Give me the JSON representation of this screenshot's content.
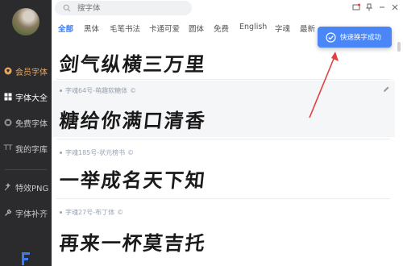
{
  "search": {
    "placeholder": "搜字体"
  },
  "sidebar": {
    "items": [
      {
        "label": "会员字体",
        "icon": "diamond-icon"
      },
      {
        "label": "字体大全",
        "icon": "grid-icon"
      },
      {
        "label": "免费字体",
        "icon": "free-icon"
      },
      {
        "label": "我的字库",
        "icon": "font-icon"
      },
      {
        "label": "特效PNG",
        "icon": "effect-icon"
      },
      {
        "label": "字体补齐",
        "icon": "wrench-icon"
      }
    ]
  },
  "tabs": [
    "全部",
    "黑体",
    "毛笔书法",
    "卡通可爱",
    "圆体",
    "免费",
    "English",
    "字魂",
    "最新"
  ],
  "toast": {
    "text": "快速换字成功"
  },
  "fonts": [
    {
      "name": "",
      "sample": "剑气纵横三万里"
    },
    {
      "name": "字魂64号-萌趣软糖体",
      "sample": "糖给你满口清香"
    },
    {
      "name": "字魂185号-状元榜书",
      "sample": "一举成名天下知"
    },
    {
      "name": "字魂27号-布丁体",
      "sample": "再来一杯莫吉托"
    }
  ],
  "copyright_glyph": "©",
  "colors": {
    "accent": "#3b7cf4",
    "vip": "#e8a65d",
    "sidebar_bg": "#2b2b2e",
    "toast_bg": "#4a86f7",
    "arrow": "#e04040"
  }
}
